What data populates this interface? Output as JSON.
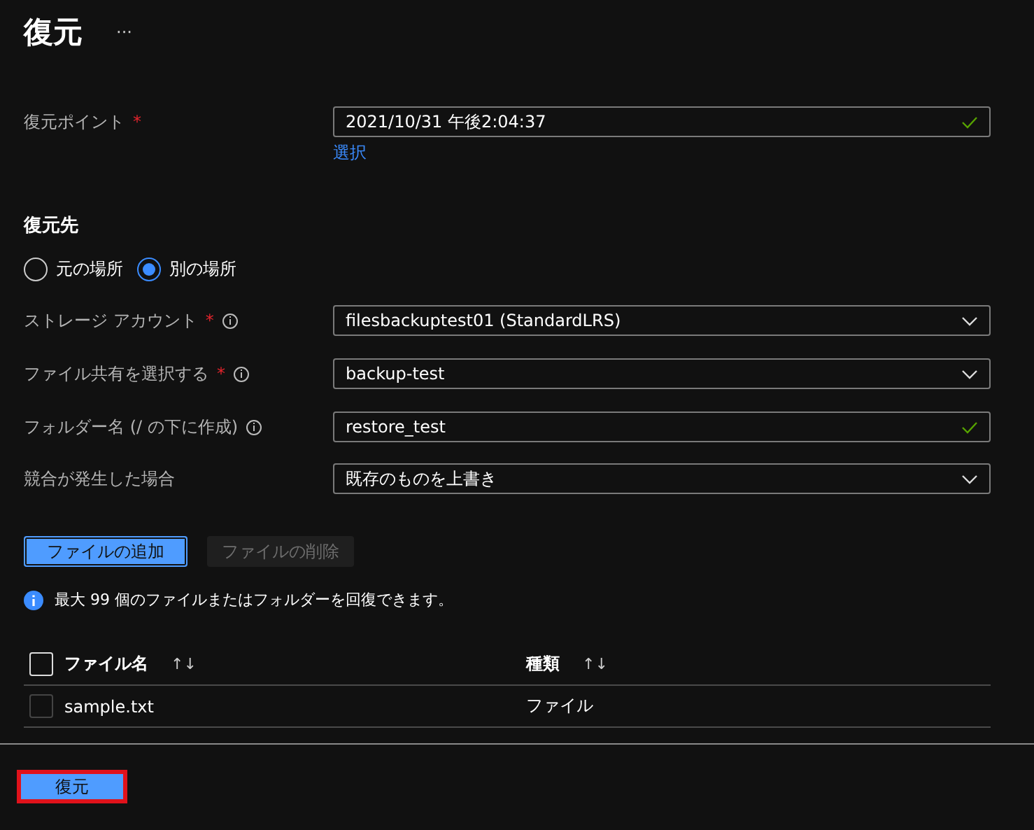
{
  "header": {
    "title": "復元",
    "more": "···"
  },
  "restore_point": {
    "label": "復元ポイント",
    "required_mark": "*",
    "value": "2021/10/31 午後2:04:37",
    "valid": true,
    "link": "選択"
  },
  "destination": {
    "heading": "復元先",
    "options": [
      {
        "label": "元の場所",
        "selected": false
      },
      {
        "label": "別の場所",
        "selected": true
      }
    ]
  },
  "fields": [
    {
      "label": "ストレージ アカウント",
      "required_mark": "*",
      "info": true,
      "kind": "dropdown",
      "value": "filesbackuptest01 (StandardLRS)"
    },
    {
      "label": "ファイル共有を選択する",
      "required_mark": "*",
      "info": true,
      "kind": "dropdown",
      "value": "backup-test"
    },
    {
      "label": "フォルダー名 (/ の下に作成)",
      "info": true,
      "kind": "text",
      "value": "restore_test",
      "valid": true
    },
    {
      "label": "競合が発生した場合",
      "info": false,
      "kind": "dropdown",
      "value": "既存のものを上書き"
    }
  ],
  "file_buttons": [
    {
      "label": "ファイルの追加",
      "disabled": false
    },
    {
      "label": "ファイルの削除",
      "disabled": true
    }
  ],
  "info_message": "最大 99 個のファイルまたはフォルダーを回復できます。",
  "table": {
    "columns": [
      {
        "label": "ファイル名",
        "sort": "↑↓"
      },
      {
        "label": "種類",
        "sort": "↑↓"
      }
    ],
    "all_checked": false,
    "rows": [
      {
        "checked": false,
        "cells": [
          "sample.txt",
          "ファイル"
        ]
      }
    ]
  },
  "footer": {
    "button": "復元",
    "highlighted": true
  }
}
